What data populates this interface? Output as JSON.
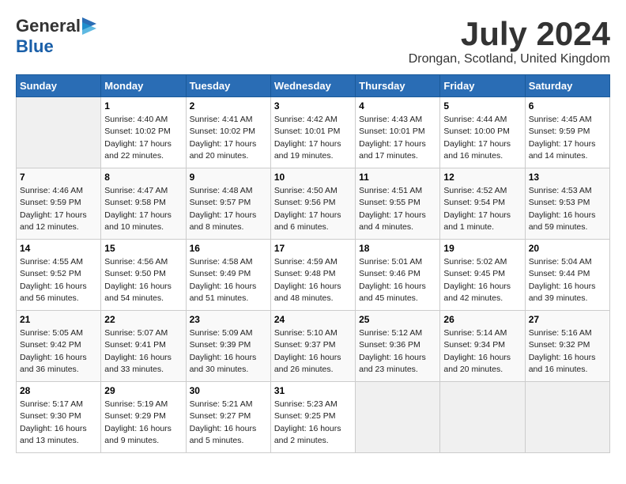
{
  "header": {
    "logo_general": "General",
    "logo_blue": "Blue",
    "month_year": "July 2024",
    "location": "Drongan, Scotland, United Kingdom"
  },
  "days_of_week": [
    "Sunday",
    "Monday",
    "Tuesday",
    "Wednesday",
    "Thursday",
    "Friday",
    "Saturday"
  ],
  "weeks": [
    [
      {
        "day": "",
        "info": ""
      },
      {
        "day": "1",
        "info": "Sunrise: 4:40 AM\nSunset: 10:02 PM\nDaylight: 17 hours\nand 22 minutes."
      },
      {
        "day": "2",
        "info": "Sunrise: 4:41 AM\nSunset: 10:02 PM\nDaylight: 17 hours\nand 20 minutes."
      },
      {
        "day": "3",
        "info": "Sunrise: 4:42 AM\nSunset: 10:01 PM\nDaylight: 17 hours\nand 19 minutes."
      },
      {
        "day": "4",
        "info": "Sunrise: 4:43 AM\nSunset: 10:01 PM\nDaylight: 17 hours\nand 17 minutes."
      },
      {
        "day": "5",
        "info": "Sunrise: 4:44 AM\nSunset: 10:00 PM\nDaylight: 17 hours\nand 16 minutes."
      },
      {
        "day": "6",
        "info": "Sunrise: 4:45 AM\nSunset: 9:59 PM\nDaylight: 17 hours\nand 14 minutes."
      }
    ],
    [
      {
        "day": "7",
        "info": "Sunrise: 4:46 AM\nSunset: 9:59 PM\nDaylight: 17 hours\nand 12 minutes."
      },
      {
        "day": "8",
        "info": "Sunrise: 4:47 AM\nSunset: 9:58 PM\nDaylight: 17 hours\nand 10 minutes."
      },
      {
        "day": "9",
        "info": "Sunrise: 4:48 AM\nSunset: 9:57 PM\nDaylight: 17 hours\nand 8 minutes."
      },
      {
        "day": "10",
        "info": "Sunrise: 4:50 AM\nSunset: 9:56 PM\nDaylight: 17 hours\nand 6 minutes."
      },
      {
        "day": "11",
        "info": "Sunrise: 4:51 AM\nSunset: 9:55 PM\nDaylight: 17 hours\nand 4 minutes."
      },
      {
        "day": "12",
        "info": "Sunrise: 4:52 AM\nSunset: 9:54 PM\nDaylight: 17 hours\nand 1 minute."
      },
      {
        "day": "13",
        "info": "Sunrise: 4:53 AM\nSunset: 9:53 PM\nDaylight: 16 hours\nand 59 minutes."
      }
    ],
    [
      {
        "day": "14",
        "info": "Sunrise: 4:55 AM\nSunset: 9:52 PM\nDaylight: 16 hours\nand 56 minutes."
      },
      {
        "day": "15",
        "info": "Sunrise: 4:56 AM\nSunset: 9:50 PM\nDaylight: 16 hours\nand 54 minutes."
      },
      {
        "day": "16",
        "info": "Sunrise: 4:58 AM\nSunset: 9:49 PM\nDaylight: 16 hours\nand 51 minutes."
      },
      {
        "day": "17",
        "info": "Sunrise: 4:59 AM\nSunset: 9:48 PM\nDaylight: 16 hours\nand 48 minutes."
      },
      {
        "day": "18",
        "info": "Sunrise: 5:01 AM\nSunset: 9:46 PM\nDaylight: 16 hours\nand 45 minutes."
      },
      {
        "day": "19",
        "info": "Sunrise: 5:02 AM\nSunset: 9:45 PM\nDaylight: 16 hours\nand 42 minutes."
      },
      {
        "day": "20",
        "info": "Sunrise: 5:04 AM\nSunset: 9:44 PM\nDaylight: 16 hours\nand 39 minutes."
      }
    ],
    [
      {
        "day": "21",
        "info": "Sunrise: 5:05 AM\nSunset: 9:42 PM\nDaylight: 16 hours\nand 36 minutes."
      },
      {
        "day": "22",
        "info": "Sunrise: 5:07 AM\nSunset: 9:41 PM\nDaylight: 16 hours\nand 33 minutes."
      },
      {
        "day": "23",
        "info": "Sunrise: 5:09 AM\nSunset: 9:39 PM\nDaylight: 16 hours\nand 30 minutes."
      },
      {
        "day": "24",
        "info": "Sunrise: 5:10 AM\nSunset: 9:37 PM\nDaylight: 16 hours\nand 26 minutes."
      },
      {
        "day": "25",
        "info": "Sunrise: 5:12 AM\nSunset: 9:36 PM\nDaylight: 16 hours\nand 23 minutes."
      },
      {
        "day": "26",
        "info": "Sunrise: 5:14 AM\nSunset: 9:34 PM\nDaylight: 16 hours\nand 20 minutes."
      },
      {
        "day": "27",
        "info": "Sunrise: 5:16 AM\nSunset: 9:32 PM\nDaylight: 16 hours\nand 16 minutes."
      }
    ],
    [
      {
        "day": "28",
        "info": "Sunrise: 5:17 AM\nSunset: 9:30 PM\nDaylight: 16 hours\nand 13 minutes."
      },
      {
        "day": "29",
        "info": "Sunrise: 5:19 AM\nSunset: 9:29 PM\nDaylight: 16 hours\nand 9 minutes."
      },
      {
        "day": "30",
        "info": "Sunrise: 5:21 AM\nSunset: 9:27 PM\nDaylight: 16 hours\nand 5 minutes."
      },
      {
        "day": "31",
        "info": "Sunrise: 5:23 AM\nSunset: 9:25 PM\nDaylight: 16 hours\nand 2 minutes."
      },
      {
        "day": "",
        "info": ""
      },
      {
        "day": "",
        "info": ""
      },
      {
        "day": "",
        "info": ""
      }
    ]
  ]
}
